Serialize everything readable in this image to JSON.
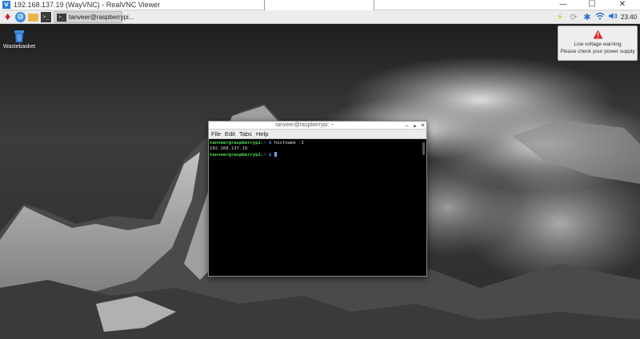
{
  "vnc_window": {
    "title": "192.168.137.19 (WayVNC) - RealVNC Viewer",
    "app_icon_letter": "V",
    "minimize_glyph": "—",
    "maximize_glyph": "☐",
    "close_glyph": "✕"
  },
  "panel": {
    "launcher_icons": [
      "raspberry-icon",
      "browser-icon",
      "file-manager-icon",
      "terminal-icon"
    ],
    "terminal_glyph": ">_",
    "taskbar_item": {
      "label": "tanveer@raspberrypi..."
    },
    "tray_icons": [
      "power-warning-icon",
      "update-icon",
      "bluetooth-icon",
      "wifi-icon",
      "volume-icon"
    ],
    "clock": "23:40"
  },
  "desktop": {
    "icons": [
      {
        "label": "Wastebasket",
        "icon": "wastebasket-icon"
      }
    ]
  },
  "notification": {
    "icon": "warning-icon",
    "line1": "Low voltage warning",
    "line2": "Please check your power supply"
  },
  "terminal": {
    "title": "tanveer@raspberrypi: ~",
    "menu": [
      "File",
      "Edit",
      "Tabs",
      "Help"
    ],
    "lines": [
      {
        "user": "tanveer@raspberrypi",
        "path": ":~ $",
        "command": " hostname -I"
      },
      {
        "output": "192.168.137.19"
      },
      {
        "user": "tanveer@raspberrypi",
        "path": ":~ $",
        "command": " "
      }
    ]
  },
  "colors": {
    "prompt_user": "#4fe04f",
    "prompt_path": "#5b8cff",
    "warning_red": "#d42a2a"
  }
}
